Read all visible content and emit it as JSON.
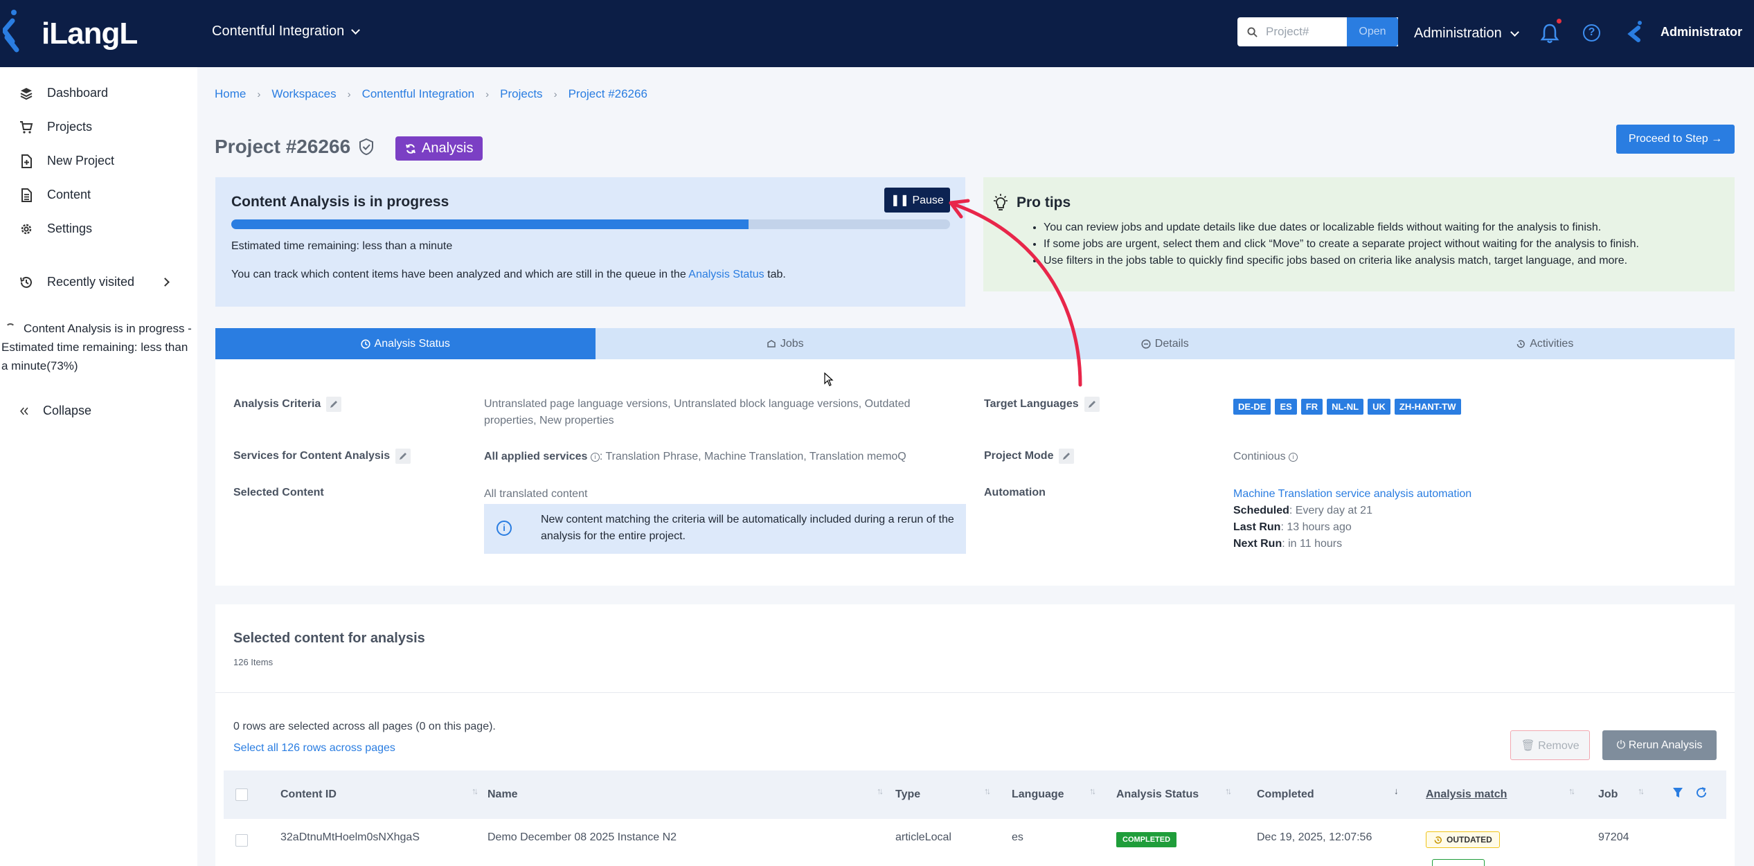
{
  "app": {
    "logo_text": "iLangL",
    "workspace_switcher": "Contentful Integration",
    "search_placeholder": "Project#",
    "open_label": "Open",
    "admin_menu": "Administration",
    "user_name": "Administrator"
  },
  "sidebar": {
    "items": [
      {
        "label": "Dashboard",
        "icon": "layers-icon"
      },
      {
        "label": "Projects",
        "icon": "cart-icon"
      },
      {
        "label": "New Project",
        "icon": "new-file-icon"
      },
      {
        "label": "Content",
        "icon": "document-icon"
      },
      {
        "label": "Settings",
        "icon": "gear-icon"
      }
    ],
    "recently_visited": "Recently visited",
    "progress_note": "Content Analysis is in progress - Estimated time remaining: less than a minute(73%)",
    "collapse": "Collapse"
  },
  "breadcrumb": [
    "Home",
    "Workspaces",
    "Contentful Integration",
    "Projects",
    "Project #26266"
  ],
  "page": {
    "title": "Project #26266",
    "status": "Analysis",
    "proceed_label": "Proceed to Step"
  },
  "analysis": {
    "heading": "Content Analysis is in progress",
    "pause_label": "Pause",
    "progress_fraction": 0.72,
    "eta": "Estimated time remaining: less than a minute",
    "track_prefix": "You can track which content items have been analyzed and which are still in the queue in the",
    "track_link": "Analysis Status",
    "track_suffix": "tab."
  },
  "tips": {
    "heading": "Pro tips",
    "items": [
      "You can review jobs and update details like due dates or localizable fields without waiting for the analysis to finish.",
      "If some jobs are urgent, select them and click “Move” to create a separate project without waiting for the analysis to finish.",
      "Use filters in the jobs table to quickly find specific jobs based on criteria like analysis match, target language, and more."
    ]
  },
  "tabs": [
    {
      "label": "Analysis Status",
      "active": true
    },
    {
      "label": "Jobs",
      "active": false
    },
    {
      "label": "Details",
      "active": false
    },
    {
      "label": "Activities",
      "active": false
    }
  ],
  "info": {
    "criteria_label": "Analysis Criteria",
    "criteria_value": "Untranslated page language versions, Untranslated block language versions, Outdated properties, New properties",
    "services_label": "Services for Content Analysis",
    "services_bold": "All applied services",
    "services_value": ": Translation Phrase, Machine Translation, Translation memoQ",
    "selected_label": "Selected Content",
    "selected_value": "All translated content",
    "notice": "New content matching the criteria will be automatically included during a rerun of the analysis for the entire project.",
    "target_label": "Target Languages",
    "languages": [
      "DE-DE",
      "ES",
      "FR",
      "NL-NL",
      "UK",
      "ZH-HANT-TW"
    ],
    "mode_label": "Project Mode",
    "mode_value": "Continious",
    "automation_label": "Automation",
    "automation_link": "Machine Translation service analysis automation",
    "scheduled_label": "Scheduled",
    "scheduled_value": ": Every day at 21",
    "last_run_label": "Last Run",
    "last_run_value": ": 13 hours ago",
    "next_run_label": "Next Run",
    "next_run_value": ": in 11 hours"
  },
  "content": {
    "heading": "Selected content for analysis",
    "count": "126 Items",
    "rows_selected": "0 rows are selected across all pages (0 on this page).",
    "select_all": "Select all 126 rows across pages",
    "remove_label": "Remove",
    "rerun_label": "Rerun Analysis",
    "columns": [
      "Content ID",
      "Name",
      "Type",
      "Language",
      "Analysis Status",
      "Completed",
      "Analysis match",
      "Job"
    ],
    "rows": [
      {
        "content_id": "32aDtnuMtHoelm0sNXhgaS",
        "name": "Demo December 08 2025 Instance N2",
        "type": "articleLocal",
        "language": "es",
        "status": "COMPLETED",
        "completed": "Dec 19, 2025, 12:07:56",
        "match": "OUTDATED",
        "job": "97204"
      }
    ]
  },
  "colors": {
    "nav_bg": "#0c1e46",
    "accent": "#2a7de1",
    "status_purple": "#7b3fc4",
    "completed_green": "#1f9d3a",
    "annotation_red": "#e8264a"
  }
}
